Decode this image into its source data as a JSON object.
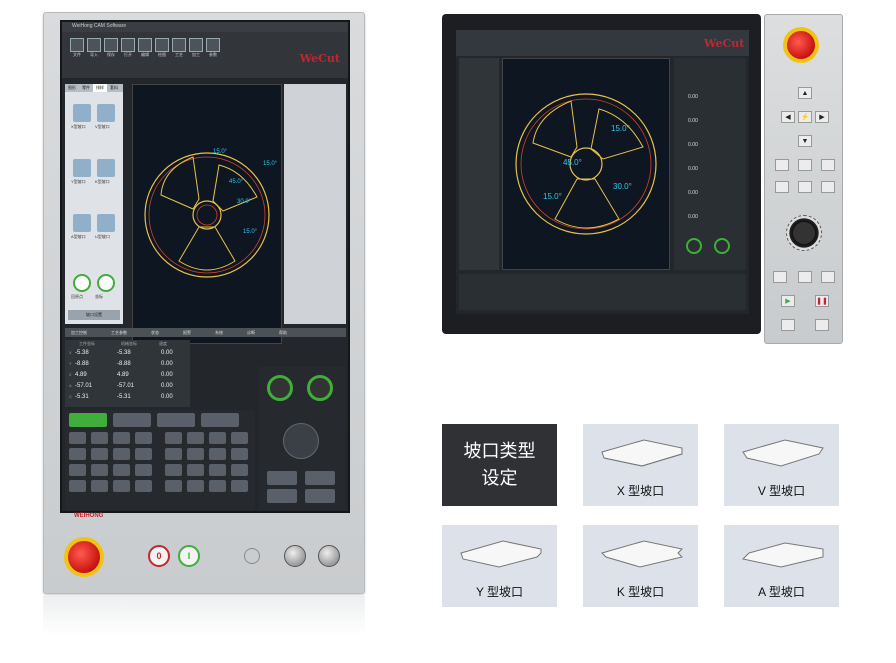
{
  "vertical_panel": {
    "app_title": "WeiHong CAM  Software",
    "logo_text": "WeCut",
    "toolbar": [
      "文件",
      "导入",
      "保存",
      "打开",
      "编辑",
      "绘图",
      "工艺",
      "加工",
      "参数"
    ],
    "side_tabs": [
      "图形",
      "零件",
      "排样",
      "套料"
    ],
    "tiles": [
      {
        "label": "X型坡口"
      },
      {
        "label": "V型坡口"
      },
      {
        "label": "Y型坡口"
      },
      {
        "label": "K型坡口"
      },
      {
        "label": "A型坡口"
      },
      {
        "label": "U型坡口"
      },
      {
        "label": "回原点"
      },
      {
        "label": "坐标"
      }
    ],
    "side_button": "坡口设置",
    "angle_labels": [
      "15.0°",
      "45.0°",
      "30.0°",
      "15.0°",
      "15.0°"
    ],
    "bottom_tabs": [
      "加工控制",
      "工艺参数",
      "状态",
      "报警",
      "系统",
      "诊断",
      "帮助"
    ],
    "coords_header": [
      "工件坐标",
      "机械坐标",
      "速度"
    ],
    "coords": [
      {
        "axis": "X",
        "work": "-5.38",
        "mach": "-5.38",
        "speed": "0.00"
      },
      {
        "axis": "Y",
        "work": "-8.88",
        "mach": "-8.88",
        "speed": "0.00"
      },
      {
        "axis": "Z",
        "work": "4.89",
        "mach": "4.89",
        "speed": "0.00"
      },
      {
        "axis": "A",
        "work": "-57.01",
        "mach": "-57.01",
        "speed": "0.00"
      },
      {
        "axis": "C",
        "work": "-5.31",
        "mach": "-5.31",
        "speed": "0.00"
      }
    ],
    "speed_unit": "mm",
    "brand_text": "WEIHONG",
    "stop_symbol": "0",
    "start_symbol": "I"
  },
  "horizontal_panel": {
    "logo_text": "WeCut",
    "angle_labels": [
      "15.0°",
      "45.0°",
      "30.0°",
      "15.0°"
    ],
    "readouts": [
      "0.00",
      "0.00",
      "0.00",
      "0.00",
      "0.00",
      "0.00"
    ]
  },
  "bevel_types": {
    "header": "坡口类型\n设定",
    "items": [
      {
        "caption": "X 型坡口"
      },
      {
        "caption": "V 型坡口"
      },
      {
        "caption": "Y 型坡口"
      },
      {
        "caption": "K 型坡口"
      },
      {
        "caption": "A 型坡口"
      }
    ]
  },
  "colors": {
    "brand_red": "#c2262e",
    "estop_red": "#d9140f",
    "estop_yellow": "#f0c317",
    "canvas_bg": "#0d1621",
    "path_yellow": "#e7c14a",
    "path_red": "#d1432f",
    "label_cyan": "#34c6e8",
    "active_green": "#3fae3a",
    "tile_bg": "#dde2ea"
  }
}
